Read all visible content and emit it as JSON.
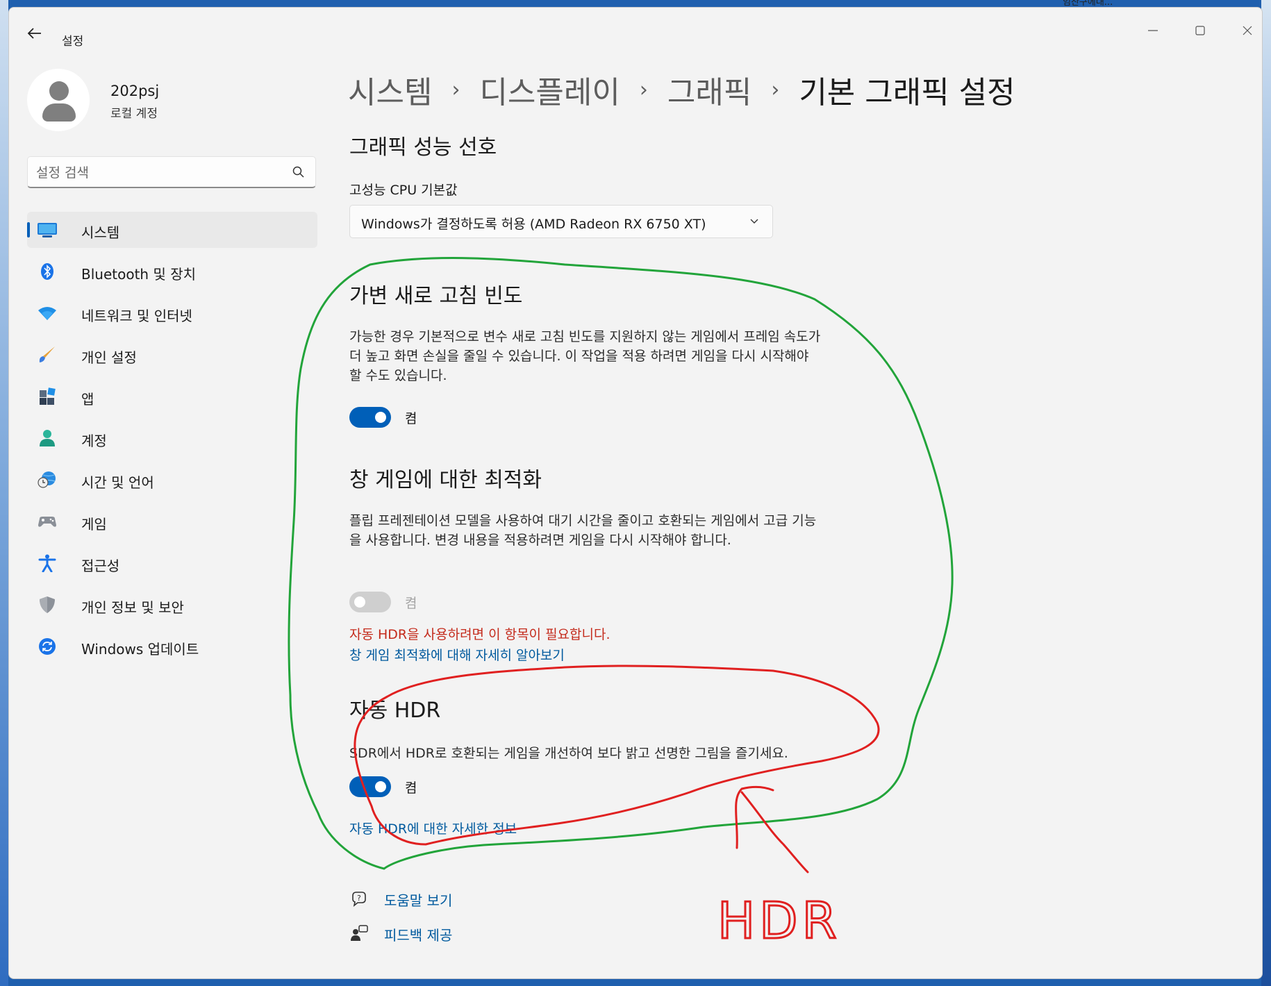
{
  "desktop": {
    "peek_text": "임찬구에대..."
  },
  "window": {
    "title": "설정",
    "back_icon": "back-arrow-icon",
    "controls": {
      "minimize": "—",
      "maximize": "☐",
      "close": "✕"
    }
  },
  "profile": {
    "name": "202psj",
    "account_type": "로컬 계정"
  },
  "search": {
    "placeholder": "설정 검색",
    "value": ""
  },
  "sidebar": {
    "items": [
      {
        "label": "시스템",
        "icon": "monitor-icon",
        "active": true
      },
      {
        "label": "Bluetooth 및 장치",
        "icon": "bluetooth-icon"
      },
      {
        "label": "네트워크 및 인터넷",
        "icon": "wifi-icon"
      },
      {
        "label": "개인 설정",
        "icon": "paintbrush-icon"
      },
      {
        "label": "앱",
        "icon": "apps-icon"
      },
      {
        "label": "계정",
        "icon": "account-icon"
      },
      {
        "label": "시간 및 언어",
        "icon": "globe-clock-icon"
      },
      {
        "label": "게임",
        "icon": "gamepad-icon"
      },
      {
        "label": "접근성",
        "icon": "accessibility-icon"
      },
      {
        "label": "개인 정보 및 보안",
        "icon": "shield-icon"
      },
      {
        "label": "Windows 업데이트",
        "icon": "update-icon"
      }
    ]
  },
  "breadcrumb": {
    "items": [
      "시스템",
      "디스플레이",
      "그래픽",
      "기본 그래픽 설정"
    ],
    "separator": "›"
  },
  "graphics_preference": {
    "heading": "그래픽 성능 선호",
    "label": "고성능 CPU 기본값",
    "dropdown_value": "Windows가 결정하도록 허용 (AMD Radeon RX 6750 XT)"
  },
  "variable_refresh": {
    "heading": "가변 새로 고침 빈도",
    "description": "가능한 경우 기본적으로 변수 새로 고침 빈도를 지원하지 않는 게임에서 프레임 속도가 더 높고 화면 손실을 줄일 수 있습니다. 이 작업을 적용 하려면 게임을 다시 시작해야 할 수도 있습니다.",
    "toggle_state": "켬",
    "toggle_on": true
  },
  "windowed_optimization": {
    "heading": "창 게임에 대한 최적화",
    "description": "플립 프레젠테이션 모델을 사용하여 대기 시간을 줄이고 호환되는 게임에서 고급 기능을 사용합니다. 변경 내용을 적용하려면 게임을 다시 시작해야 합니다.",
    "toggle_state": "켬",
    "toggle_on": true,
    "toggle_disabled": true,
    "warning": "자동 HDR을 사용하려면 이 항목이 필요합니다.",
    "learn_more_link": "창 게임 최적화에 대해 자세히 알아보기"
  },
  "auto_hdr": {
    "heading": "자동 HDR",
    "description": "SDR에서 HDR로 호환되는 게임을 개선하여 보다 밝고 선명한 그림을 즐기세요.",
    "toggle_state": "켬",
    "toggle_on": true,
    "info_link": "자동 HDR에 대한 자세한 정보"
  },
  "footer": {
    "help_label": "도움말 보기",
    "help_icon": "help-chat-icon",
    "feedback_label": "피드백 제공",
    "feedback_icon": "feedback-icon"
  },
  "annotation": {
    "handwritten_text": "HDR",
    "green_color": "#22a43a",
    "red_color": "#e02020"
  },
  "colors": {
    "accent": "#005fb8",
    "link": "#005a9e",
    "warning": "#c42b1c",
    "window_bg": "#f3f3f3"
  }
}
